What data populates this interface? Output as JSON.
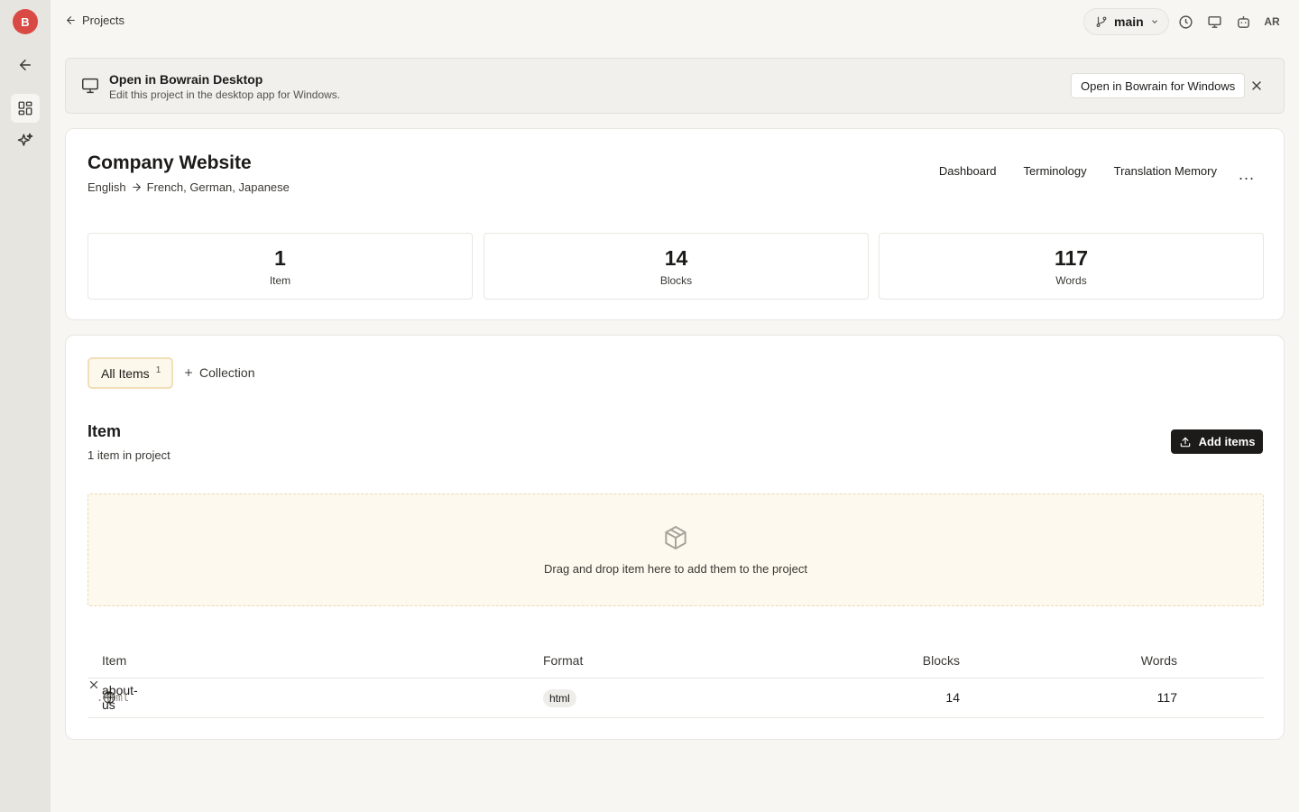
{
  "rail": {
    "logo_letter": "B"
  },
  "topbar": {
    "breadcrumb": "Projects",
    "branch": "main",
    "user_initials": "AR"
  },
  "banner": {
    "title": "Open in Bowrain Desktop",
    "subtitle": "Edit this project in the desktop app for Windows.",
    "button": "Open in Bowrain for Windows"
  },
  "project": {
    "title": "Company Website",
    "source_language": "English",
    "target_languages": "French, German, Japanese",
    "tabs": [
      "Dashboard",
      "Terminology",
      "Translation Memory"
    ],
    "more": "...",
    "stats": [
      {
        "value": "1",
        "label": "Item"
      },
      {
        "value": "14",
        "label": "Blocks"
      },
      {
        "value": "117",
        "label": "Words"
      }
    ]
  },
  "items": {
    "tab_all_label": "All Items",
    "tab_all_count": "1",
    "tab_collection_label": "Collection",
    "section_title": "Item",
    "section_subtitle": "1 item in project",
    "add_button": "Add items",
    "dropzone_text": "Drag and drop item here to add them to the project",
    "columns": [
      "Item",
      "Format",
      "Blocks",
      "Words"
    ],
    "rows": [
      {
        "name": "about-us",
        "ext": ".html",
        "format": "html",
        "blocks": "14",
        "words": "117"
      }
    ]
  },
  "colors": {
    "brand": "#d94a45",
    "accent_tab_bg": "#fdf8ec",
    "primary_button": "#1c1b19"
  }
}
